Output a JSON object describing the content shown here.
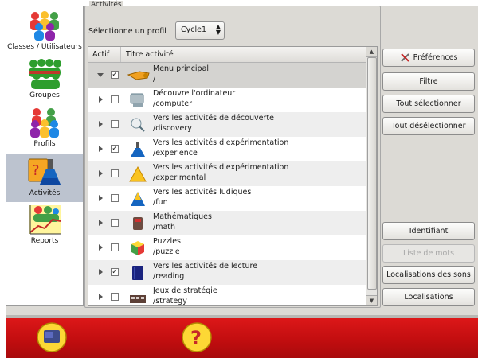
{
  "nav": {
    "items": [
      {
        "label": "Classes / Utilisateurs",
        "icon": "classes-users-icon"
      },
      {
        "label": "Groupes",
        "icon": "groups-icon"
      },
      {
        "label": "Profils",
        "icon": "profiles-icon"
      },
      {
        "label": "Activités",
        "icon": "activities-icon",
        "active": true
      },
      {
        "label": "Reports",
        "icon": "reports-chart-icon"
      }
    ]
  },
  "activities": {
    "legend": "Activités",
    "profile_label": "Sélectionne un profil :",
    "profile_value": "Cycle1",
    "columns": {
      "active": "Actif",
      "title": "Titre activité"
    },
    "rows": [
      {
        "title": "Menu principal",
        "path": "/",
        "checked": true,
        "expanded": true,
        "icon": "main-menu-icon"
      },
      {
        "title": "Découvre l'ordinateur",
        "path": "/computer",
        "checked": false,
        "icon": "computer-icon"
      },
      {
        "title": "Vers les activités de découverte",
        "path": "/discovery",
        "checked": false,
        "icon": "discovery-icon"
      },
      {
        "title": "Vers les activités d'expérimentation",
        "path": "/experience",
        "checked": true,
        "icon": "flask-icon"
      },
      {
        "title": "Vers les activités d'expérimentation",
        "path": "/experimental",
        "checked": false,
        "icon": "triangle-icon"
      },
      {
        "title": "Vers les activités ludiques",
        "path": "/fun",
        "checked": false,
        "icon": "fun-icon"
      },
      {
        "title": "Mathématiques",
        "path": "/math",
        "checked": false,
        "icon": "math-icon"
      },
      {
        "title": "Puzzles",
        "path": "/puzzle",
        "checked": false,
        "icon": "puzzle-icon"
      },
      {
        "title": "Vers les activités de lecture",
        "path": "/reading",
        "checked": true,
        "icon": "reading-icon"
      },
      {
        "title": "Jeux de stratégie",
        "path": "/strategy",
        "checked": false,
        "icon": "strategy-icon"
      }
    ]
  },
  "buttons": {
    "preferences": "Préférences",
    "filter": "Filtre",
    "select_all": "Tout sélectionner",
    "deselect_all": "Tout désélectionner",
    "login": "Identifiant",
    "word_list": "Liste de mots",
    "sound_locales": "Localisations des sons",
    "locales": "Localisations"
  },
  "bottombar": {
    "left_icon": "board-icon",
    "right_icon": "help-icon"
  },
  "colors": {
    "bottombar": "#c8101a",
    "selection": "#bcc3cf"
  }
}
